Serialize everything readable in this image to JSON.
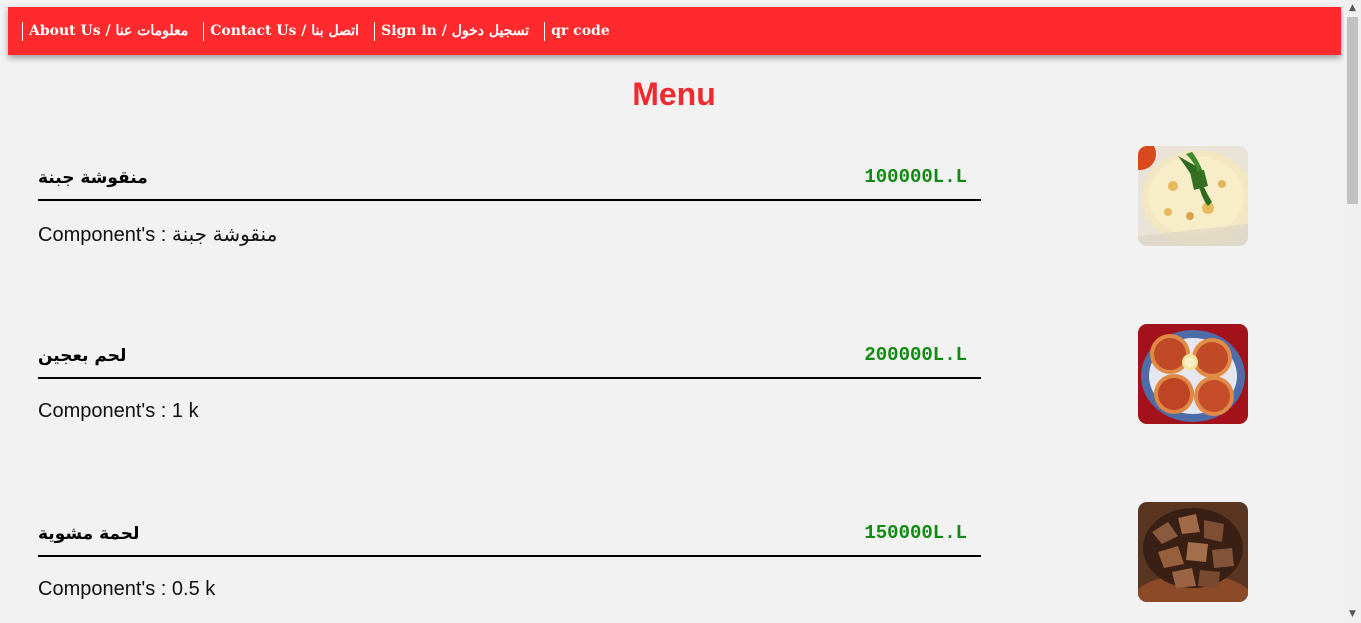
{
  "nav": {
    "links": [
      {
        "label": "About Us / معلومات عنا"
      },
      {
        "label": "Contact Us / اتصل بنا"
      },
      {
        "label": "Sign in / تسجيل دخول"
      },
      {
        "label": "qr code"
      }
    ]
  },
  "page_title": "Menu",
  "menu_items": [
    {
      "name": "منقوشة جبنة",
      "price": "100000L.L",
      "components": "Component's : منقوشة جبنة",
      "photo": "cheese-manakish-photo"
    },
    {
      "name": "لحم بعجين",
      "price": "200000L.L",
      "components": "Component's : 1 k",
      "photo": "lahm-bi-ajeen-photo"
    },
    {
      "name": "لحمة مشوية",
      "price": "150000L.L",
      "components": "Component's : 0.5 k",
      "photo": "grilled-meat-photo"
    }
  ],
  "colors": {
    "navbar": "#ff2a2e",
    "title": "#ee2b30",
    "price": "#118a11",
    "background": "#f2f2f2"
  }
}
